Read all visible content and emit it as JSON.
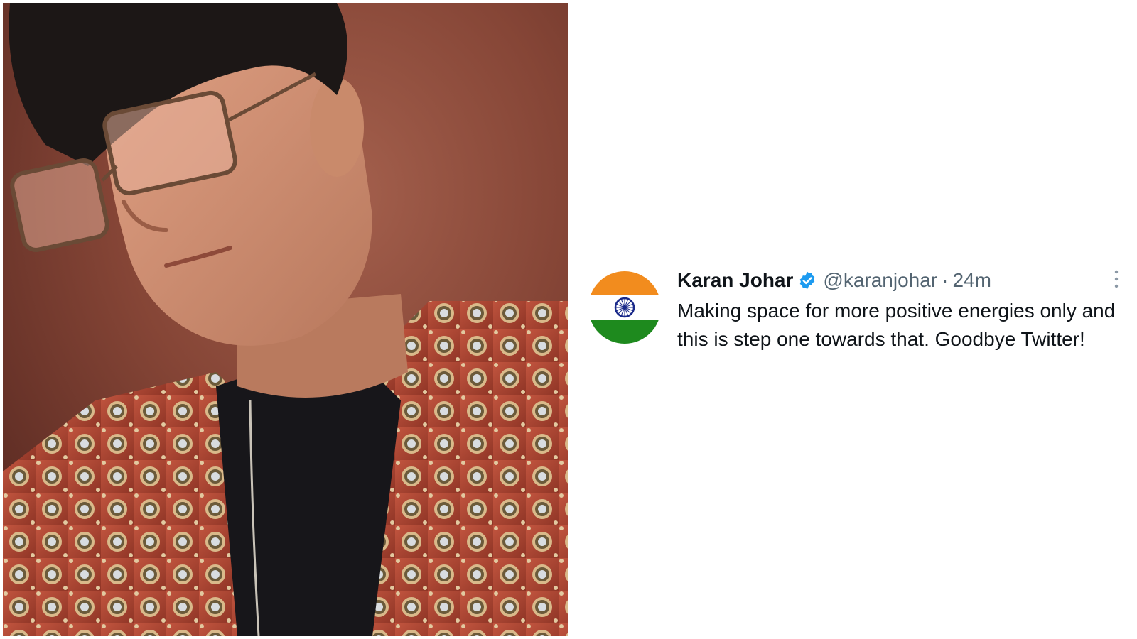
{
  "photo": {
    "subject": "portrait-photo"
  },
  "tweet": {
    "display_name": "Karan Johar",
    "handle": "@karanjohar",
    "separator": "·",
    "time": "24m",
    "text": "Making space for more positive energies only and this is step one towards that. Goodbye Twitter!",
    "verified_icon": "verified-badge-icon",
    "more_icon": "more-options-icon",
    "avatar_icon": "india-flag-avatar"
  },
  "colors": {
    "saffron": "#f28c1e",
    "green": "#1e8a1e",
    "chakra": "#1a2a8a",
    "verified": "#1d9bf0",
    "text_primary": "#0f1419",
    "text_secondary": "#536471"
  }
}
